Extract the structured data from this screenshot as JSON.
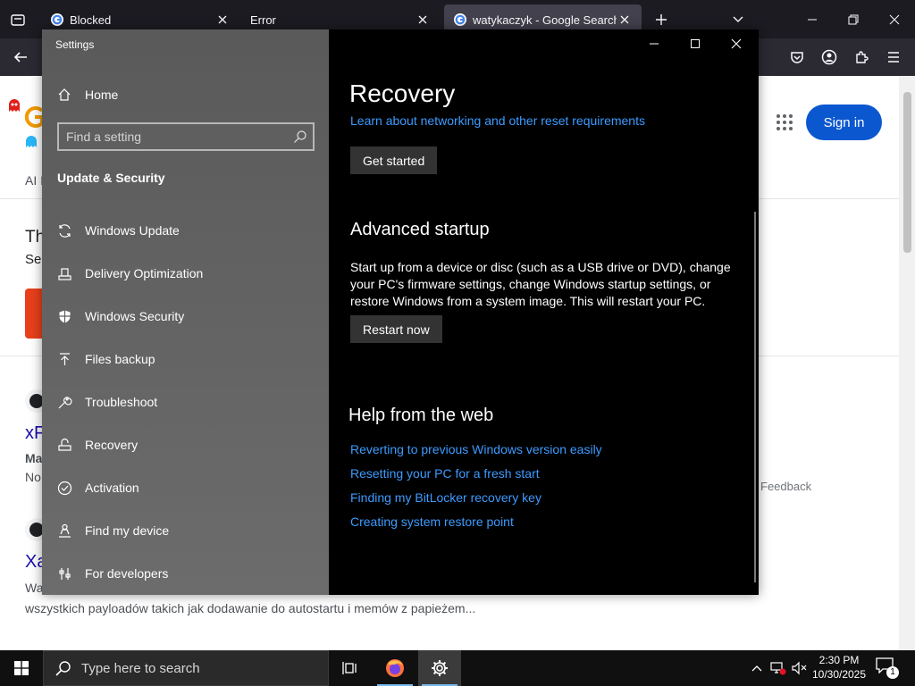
{
  "browser": {
    "tabs": [
      {
        "title": "Blocked",
        "active": false
      },
      {
        "title": "Error",
        "active": false
      },
      {
        "title": "watykaczyk - Google Search",
        "active": true
      }
    ]
  },
  "webpage": {
    "signin_label": "Sign in",
    "fragments": {
      "ai": "AI I",
      "th": "Th",
      "se": "Se",
      "xf": "xF",
      "ma": "Ma",
      "no": "No",
      "xa": "Xa",
      "wa": "Wa"
    },
    "feedback": "Feedback",
    "snippet": "wszystkich payloadów takich jak dodawanie do autostartu i memów z papieżem..."
  },
  "settings": {
    "window_title": "Settings",
    "home_label": "Home",
    "search_placeholder": "Find a setting",
    "section_title": "Update & Security",
    "nav": [
      {
        "label": "Windows Update",
        "icon": "sync-icon"
      },
      {
        "label": "Delivery Optimization",
        "icon": "delivery-icon"
      },
      {
        "label": "Windows Security",
        "icon": "shield-icon"
      },
      {
        "label": "Files backup",
        "icon": "backup-arrow-icon"
      },
      {
        "label": "Troubleshoot",
        "icon": "wrench-icon"
      },
      {
        "label": "Recovery",
        "icon": "recovery-icon"
      },
      {
        "label": "Activation",
        "icon": "check-circle-icon"
      },
      {
        "label": "Find my device",
        "icon": "person-location-icon"
      },
      {
        "label": "For developers",
        "icon": "developer-icon"
      }
    ],
    "content": {
      "title": "Recovery",
      "reset_link": "Learn about networking and other reset requirements",
      "get_started": "Get started",
      "advanced_title": "Advanced startup",
      "advanced_text": "Start up from a device or disc (such as a USB drive or DVD), change your PC's firmware settings, change Windows startup settings, or restore Windows from a system image. This will restart your PC.",
      "restart_now": "Restart now",
      "help_title": "Help from the web",
      "help_links": [
        "Reverting to previous Windows version easily",
        "Resetting your PC for a fresh start",
        "Finding my BitLocker recovery key",
        "Creating system restore point"
      ]
    }
  },
  "taskbar": {
    "search_placeholder": "Type here to search",
    "time": "2:30 PM",
    "date": "10/30/2025",
    "notification_count": "1"
  },
  "colors": {
    "accent_link": "#3c9bff",
    "google_blue": "#0b57d0",
    "taskbar_active": "#76b9ed"
  }
}
